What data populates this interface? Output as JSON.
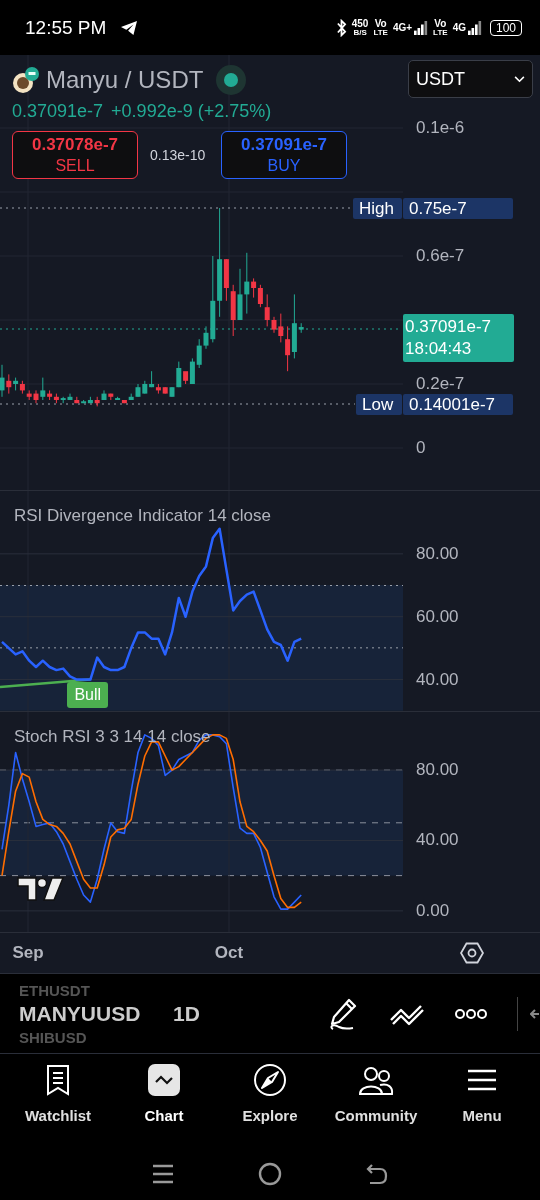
{
  "status_bar": {
    "time": "12:55 PM",
    "net_speed": {
      "value": "450",
      "unit": "B/S"
    },
    "sims": [
      {
        "volte_top": "Vo",
        "volte_bottom": "LTE",
        "network": "4G+"
      },
      {
        "volte_top": "Vo",
        "volte_bottom": "LTE",
        "network": "4G"
      }
    ],
    "battery": "100"
  },
  "symbol": {
    "title": "Manyu / USDT",
    "live": true,
    "price": "0.37091e-7",
    "change": "+0.992e-9 (+2.75%)"
  },
  "trade": {
    "sell": {
      "price": "0.37078e-7",
      "label": "SELL"
    },
    "spread": "0.13e-10",
    "buy": {
      "price": "0.37091e-7",
      "label": "BUY"
    }
  },
  "currency_select": {
    "value": "USDT"
  },
  "price_axis": {
    "labels": [
      "0.1e-6",
      "0.6e-7",
      "0.2e-7",
      "0"
    ]
  },
  "high": {
    "label": "High",
    "value": "0.75e-7"
  },
  "low": {
    "label": "Low",
    "value": "0.14001e-7"
  },
  "last_price": {
    "value": "0.37091e-7",
    "countdown": "18:04:43"
  },
  "rsi_pane": {
    "chart_data": {
      "type": "line",
      "title": "RSI Divergence Indicator 14 close",
      "ylim": [
        30,
        100
      ],
      "yticks": [
        {
          "value": 40,
          "label": "40.00"
        },
        {
          "value": 60,
          "label": "60.00"
        },
        {
          "value": 80,
          "label": "80.00"
        }
      ],
      "series": [
        {
          "color": "#2962ff",
          "values": [
            52,
            50,
            48,
            49,
            46,
            44,
            46,
            44,
            43,
            43.5,
            41,
            40,
            40,
            40,
            47,
            44,
            43,
            43,
            44,
            50,
            55,
            55,
            53,
            53,
            48,
            55,
            66,
            60,
            68,
            73,
            76,
            85,
            88,
            75,
            62,
            65,
            67,
            68,
            62,
            56,
            52,
            51,
            46,
            52,
            53
          ]
        }
      ],
      "grid": true,
      "annotations": [
        {
          "text": "Bull"
        }
      ]
    }
  },
  "stoch_pane": {
    "chart_data": {
      "type": "line",
      "title": "Stoch RSI 3 3 14 14 close",
      "ylim": [
        -12,
        113
      ],
      "grid": true,
      "yticks": [
        {
          "value": 0,
          "label": "0.00"
        },
        {
          "value": 40,
          "label": "40.00"
        },
        {
          "value": 80,
          "label": "80.00"
        }
      ],
      "series": [
        {
          "color": "#2962ff",
          "values": [
            35,
            60,
            90,
            75,
            62,
            48,
            49,
            50,
            45,
            38,
            28,
            18,
            9,
            5,
            18,
            35,
            50,
            45,
            44,
            68,
            90,
            100,
            98,
            94,
            77,
            80,
            86,
            88,
            90,
            97,
            100,
            100,
            99,
            95,
            70,
            47,
            44,
            44,
            36,
            22,
            8,
            1,
            1,
            5,
            9
          ]
        },
        {
          "color": "#ff6d00",
          "values": [
            20,
            45,
            68,
            78,
            76,
            62,
            52,
            49,
            48,
            44,
            38,
            28,
            18,
            13,
            13,
            26,
            42,
            46,
            47,
            52,
            72,
            88,
            96,
            96,
            88,
            80,
            82,
            86,
            90,
            94,
            98,
            100,
            100,
            98,
            86,
            62,
            48,
            45,
            40,
            34,
            20,
            7,
            2,
            2,
            5
          ]
        }
      ]
    }
  },
  "time_axis": [
    "Sep",
    "Oct"
  ],
  "toolbar": {
    "symbols": [
      {
        "label": "ETHUSDT",
        "selected": false
      },
      {
        "label": "MANYUUSD",
        "selected": true
      },
      {
        "label": "SHIBUSD",
        "selected": false
      }
    ],
    "interval": "1D"
  },
  "nav": [
    {
      "label": "Watchlist",
      "selected": false
    },
    {
      "label": "Chart",
      "selected": true
    },
    {
      "label": "Explore",
      "selected": false
    },
    {
      "label": "Community",
      "selected": false
    },
    {
      "label": "Menu",
      "selected": false
    }
  ]
}
